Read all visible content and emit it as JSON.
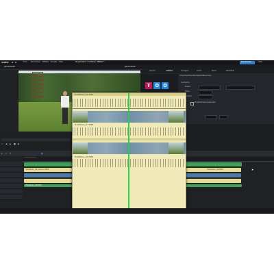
{
  "menubar": {
    "logo": "VIDEO",
    "items": [
      "Datei",
      "Bearbeiten",
      "Effekte",
      "Fenster",
      "Hilfe"
    ]
  },
  "header": {
    "project_title": "Projektdatei: Holzfallen ABBILD *",
    "timecode_left": "00:00:00:00",
    "timecode_right": "00:05:26:05",
    "export_button": "Exportieren",
    "help_label": "Hilfe"
  },
  "right_panel": {
    "tabs": [
      "Import",
      "Effekte",
      "Vorlagen",
      "Audio",
      "Store",
      "Workflow"
    ],
    "section_title": "Untertitel/Titel/Textobjekt/Bereichen",
    "group_label": "Laufweite",
    "field_labels": [
      "Breite",
      "Hohe",
      "Position"
    ],
    "checkbox_label": "Projektbreite anwenden"
  },
  "timeline": {
    "panel_label": "Arrangement",
    "clip_labels": [
      "Holzfallen_06_Version.MP4",
      "Holzfallen_08.MP4",
      "Holzfallen_09.MP4"
    ]
  },
  "zoom_overlay": {
    "labels": [
      "Holzfallen_06.MP4",
      "Holzfallen_07.MP4",
      "Holzfallen_08.MP4"
    ]
  },
  "colors": {
    "accent": "#2f7fd3",
    "playhead": "#2ad04c",
    "clip_green": "#3aa655",
    "clip_yellow": "#e8dd8f"
  }
}
